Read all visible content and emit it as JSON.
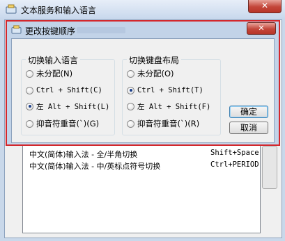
{
  "outer_window": {
    "title": "文本服务和输入语言",
    "close_glyph": "✕",
    "hotkeys": [
      {
        "action": "中文(简体)输入法 - 全/半角切换",
        "key": "Shift+Space"
      },
      {
        "action": "中文(简体)输入法 - 中/英标点符号切换",
        "key": "Ctrl+PERIOD"
      }
    ]
  },
  "dialog": {
    "title": "更改按键顺序",
    "close_glyph": "✕",
    "input_language": {
      "title": "切换输入语言",
      "options": [
        {
          "label": "未分配(N)",
          "selected": false
        },
        {
          "label": "Ctrl + Shift(C)",
          "selected": false
        },
        {
          "label": "左 Alt + Shift(L)",
          "selected": true
        },
        {
          "label": "抑音符重音(`)(G)",
          "selected": false
        }
      ]
    },
    "keyboard_layout": {
      "title": "切换键盘布局",
      "options": [
        {
          "label": "未分配(O)",
          "selected": false
        },
        {
          "label": "Ctrl + Shift(T)",
          "selected": true
        },
        {
          "label": "左 Alt + Shift(F)",
          "selected": false
        },
        {
          "label": "抑音符重音(`)(R)",
          "selected": false
        }
      ]
    },
    "ok_label": "确定",
    "cancel_label": "取消"
  },
  "colors": {
    "highlight_border": "#d4272c",
    "close_button": "#c3463a",
    "radio_dot": "#1c3f8a"
  }
}
